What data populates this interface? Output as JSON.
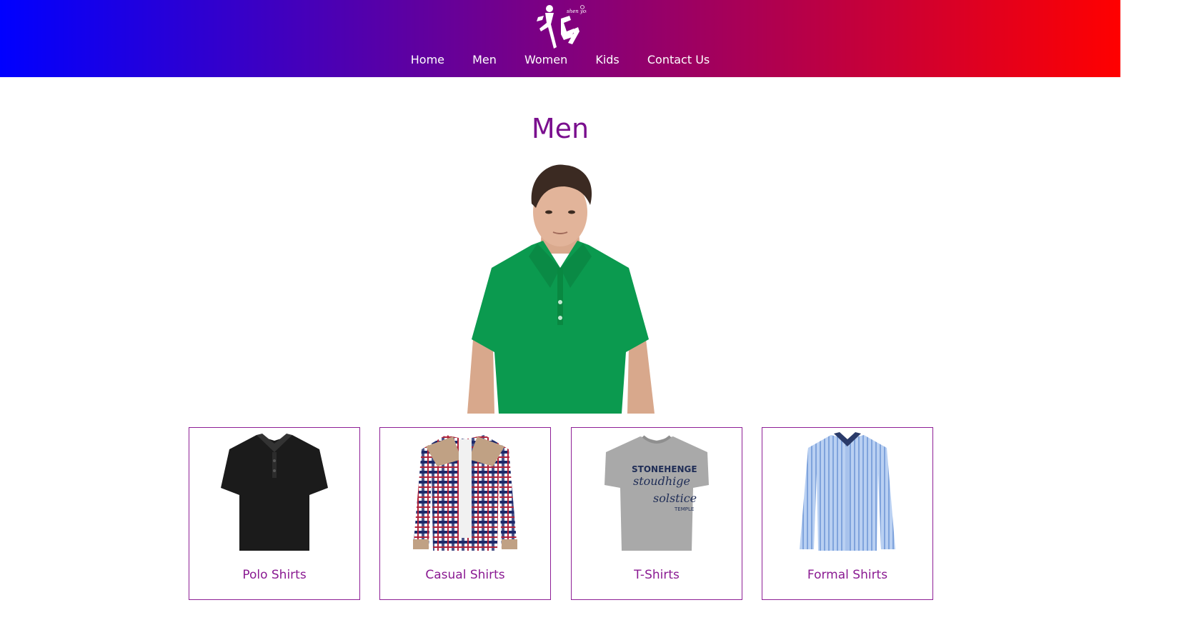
{
  "header": {
    "logo_alt": "shen you",
    "nav": [
      {
        "label": "Home"
      },
      {
        "label": "Men"
      },
      {
        "label": "Women"
      },
      {
        "label": "Kids"
      },
      {
        "label": "Contact Us"
      }
    ],
    "gradient": {
      "from": "#0000ff",
      "to": "#ff0000"
    }
  },
  "main": {
    "title": "Men",
    "title_color": "#7a0f8e",
    "hero_icon": "man-in-green-polo-shirt",
    "categories": [
      {
        "label": "Polo Shirts",
        "icon": "black-polo-shirt-icon"
      },
      {
        "label": "Casual Shirts",
        "icon": "plaid-shirt-icon"
      },
      {
        "label": "T-Shirts",
        "icon": "grey-tshirt-icon"
      },
      {
        "label": "Formal Shirts",
        "icon": "blue-formal-shirt-icon"
      }
    ],
    "card_border_color": "#8e1f96"
  }
}
